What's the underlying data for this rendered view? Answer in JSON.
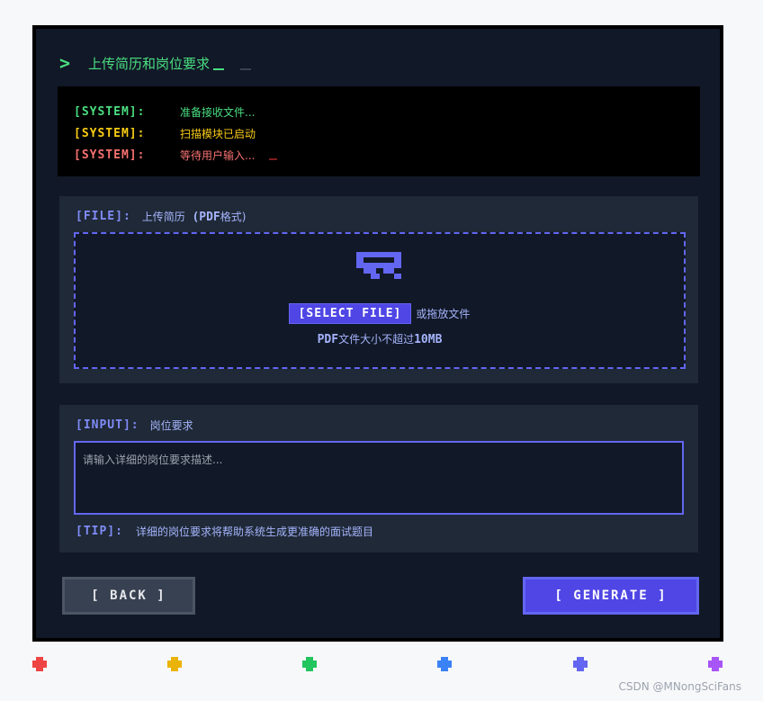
{
  "title": {
    "chevron": ">",
    "text": "上传简历和岗位要求"
  },
  "console": {
    "lines": [
      {
        "tag": "[SYSTEM]:",
        "message": "准备接收文件...",
        "color": "#4ade80"
      },
      {
        "tag": "[SYSTEM]:",
        "message": "扫描模块已启动",
        "color": "#facc15"
      },
      {
        "tag": "[SYSTEM]:",
        "message": "等待用户输入...",
        "color": "#f87171"
      }
    ]
  },
  "file_section": {
    "tag": "[FILE]:",
    "label": "上传简历",
    "format_prefix": "(PDF",
    "format_suffix": "格式)",
    "icon": "upload-icon",
    "select_button": "[SELECT FILE]",
    "drop_text": "或拖放文件",
    "hint_prefix": "PDF",
    "hint_middle": "文件大小不超过",
    "hint_size": "10MB"
  },
  "input_section": {
    "tag": "[INPUT]:",
    "label": "岗位要求",
    "placeholder": "请输入详细的岗位要求描述...",
    "value": "",
    "tip_tag": "[TIP]:",
    "tip_text": "详细的岗位要求将帮助系统生成更准确的面试题目"
  },
  "buttons": {
    "back": "[ BACK ]",
    "generate": "[ GENERATE ]"
  },
  "colors": {
    "dots": [
      "#ef4444",
      "#eab308",
      "#22c55e",
      "#3b82f6",
      "#6366f1",
      "#a855f7"
    ],
    "accent": "#4f46e5",
    "terminal_green": "#4ade80"
  },
  "watermark": "CSDN @MNongSciFans"
}
